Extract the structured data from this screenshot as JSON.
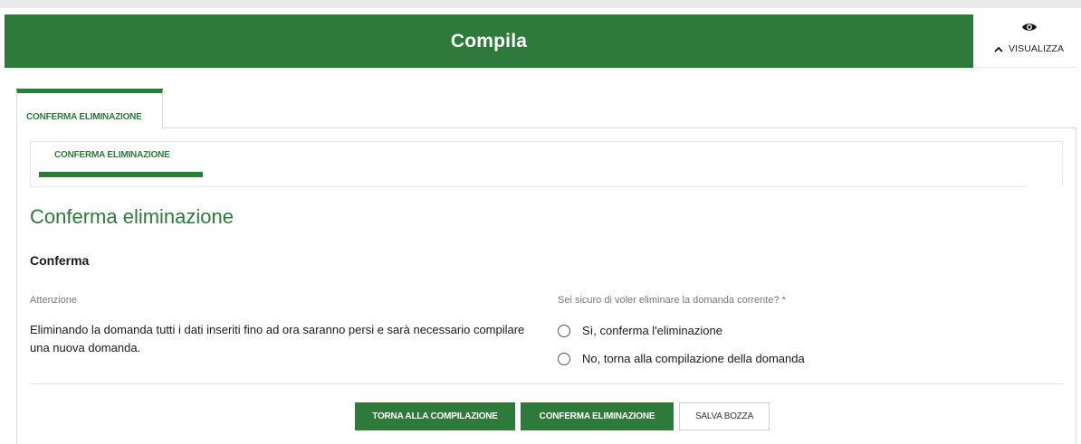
{
  "header": {
    "title": "Compila",
    "view_label": "VISUALIZZA",
    "view_icon": "eye-icon",
    "toggle_icon": "chevron-up-icon"
  },
  "tabs": [
    {
      "label": "CONFERMA ELIMINAZIONE",
      "active": true
    }
  ],
  "subnav": {
    "items": [
      {
        "label": "CONFERMA ELIMINAZIONE",
        "active": true
      }
    ]
  },
  "page": {
    "title": "Conferma eliminazione",
    "section_title": "Conferma"
  },
  "warning": {
    "label": "Attenzione",
    "text": "Eliminando la domanda tutti i dati inseriti fino ad ora saranno persi e sarà necessario compilare una nuova domanda."
  },
  "question": {
    "label": "Sei sicuro di voler eliminare la domanda corrente? *",
    "options": [
      {
        "label": "Sì, conferma l'eliminazione",
        "selected": false
      },
      {
        "label": "No, torna alla compilazione della domanda",
        "selected": false
      }
    ]
  },
  "actions": {
    "back_label": "TORNA ALLA COMPILAZIONE",
    "confirm_label": "CONFERMA ELIMINAZIONE",
    "draft_label": "SALVA BOZZA"
  },
  "colors": {
    "brand_green": "#2d7a3a",
    "background": "#ffffff",
    "muted_text": "#777777"
  }
}
